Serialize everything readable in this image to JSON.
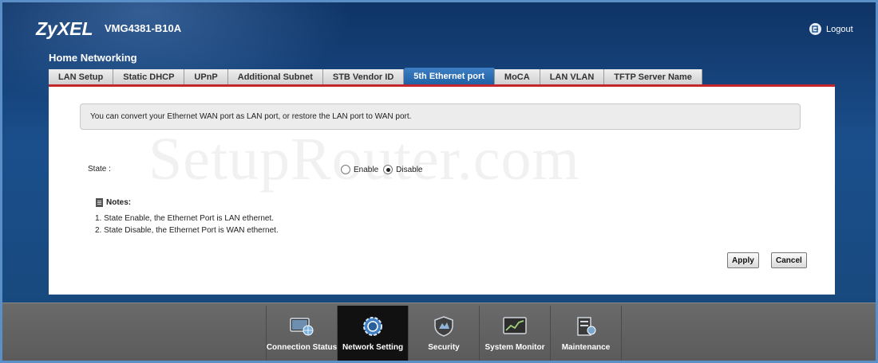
{
  "header": {
    "brand": "ZyXEL",
    "model": "VMG4381-B10A",
    "logout_label": "Logout",
    "page_title": "Home Networking",
    "watermark": "SetupRouter.com"
  },
  "tabs": [
    {
      "label": "LAN Setup",
      "active": false
    },
    {
      "label": "Static DHCP",
      "active": false
    },
    {
      "label": "UPnP",
      "active": false
    },
    {
      "label": "Additional Subnet",
      "active": false
    },
    {
      "label": "STB Vendor ID",
      "active": false
    },
    {
      "label": "5th Ethernet port",
      "active": true
    },
    {
      "label": "MoCA",
      "active": false
    },
    {
      "label": "LAN VLAN",
      "active": false
    },
    {
      "label": "TFTP Server Name",
      "active": false
    }
  ],
  "main": {
    "info": "You can convert your Ethernet WAN port as LAN port, or restore the LAN port to WAN port.",
    "state_label": "State :",
    "state_options": [
      {
        "label": "Enable",
        "checked": false
      },
      {
        "label": "Disable",
        "checked": true
      }
    ],
    "notes_title": "Notes:",
    "notes": [
      "1. State Enable, the Ethernet Port is LAN ethernet.",
      "2. State Disable, the Ethernet Port is WAN ethernet."
    ],
    "apply_label": "Apply",
    "cancel_label": "Cancel"
  },
  "bottom_nav": [
    {
      "label": "Connection Status",
      "icon": "monitor-globe-icon",
      "active": false
    },
    {
      "label": "Network Setting",
      "icon": "network-gear-icon",
      "active": true
    },
    {
      "label": "Security",
      "icon": "shield-icon",
      "active": false
    },
    {
      "label": "System Monitor",
      "icon": "chart-monitor-icon",
      "active": false
    },
    {
      "label": "Maintenance",
      "icon": "maintenance-tools-icon",
      "active": false
    }
  ],
  "colors": {
    "background": "#1b4f8c",
    "active_tab": "#2f6fb3",
    "accent_line": "#c4262e",
    "bottom_bar": "#5f5f5f",
    "active_nav": "#111111"
  }
}
